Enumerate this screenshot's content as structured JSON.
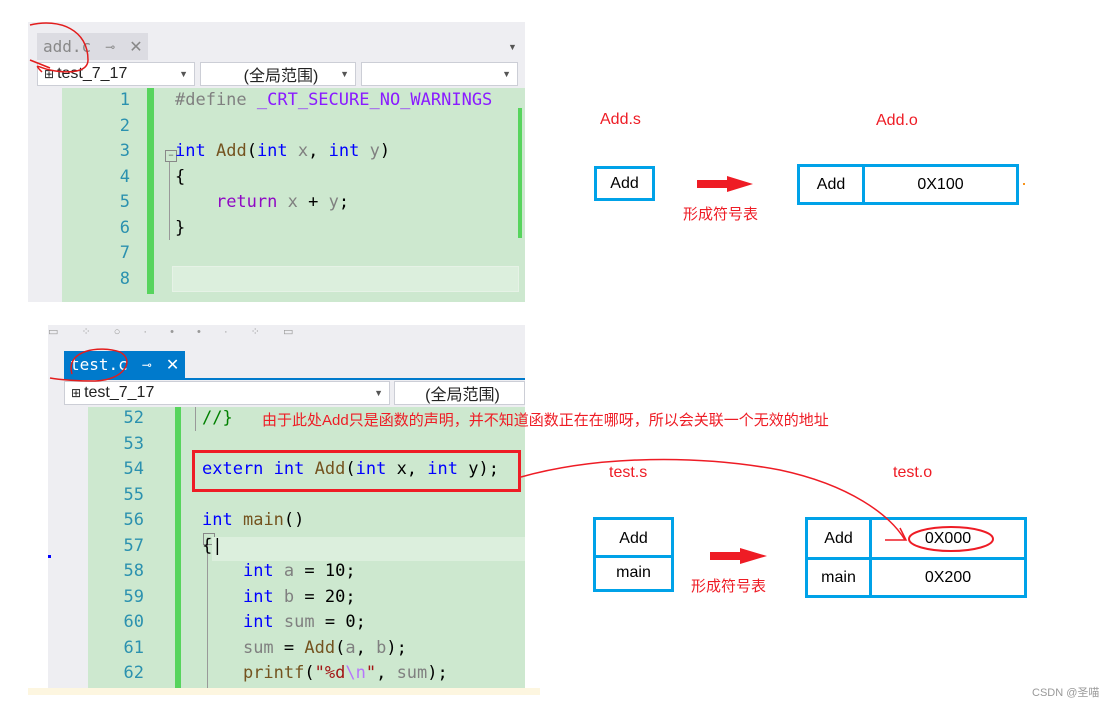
{
  "top_editor": {
    "tab_label": "add.c",
    "pin_icon": "pin-icon",
    "close_icon": "close-icon",
    "project_dropdown": "test_7_17",
    "scope_dropdown": "(全局范围)",
    "member_dropdown": "",
    "line_numbers": [
      "1",
      "2",
      "3",
      "4",
      "5",
      "6",
      "7",
      "8"
    ]
  },
  "bottom_editor": {
    "tab_label": "test.c",
    "project_dropdown": "test_7_17",
    "scope_dropdown": "(全局范围)",
    "line_numbers": [
      "52",
      "53",
      "54",
      "55",
      "56",
      "57",
      "58",
      "59",
      "60",
      "61",
      "62"
    ],
    "annotation": "由于此处Add只是函数的声明，并不知道函数正在在哪呀，所以会关联一个无效的地址"
  },
  "top_diagram": {
    "source_label": "Add.s",
    "source_symbols": [
      "Add"
    ],
    "arrow_label": "形成符号表",
    "object_label": "Add.o",
    "table": [
      {
        "symbol": "Add",
        "address": "0X100"
      }
    ]
  },
  "bottom_diagram": {
    "source_label": "test.s",
    "source_symbols": [
      "Add",
      "main"
    ],
    "arrow_label": "形成符号表",
    "object_label": "test.o",
    "table": [
      {
        "symbol": "Add",
        "address": "0X000"
      },
      {
        "symbol": "main",
        "address": "0X200"
      }
    ]
  },
  "watermark": "CSDN @圣喵",
  "colors": {
    "annotation_red": "#ee1c25",
    "table_blue": "#00a2e8",
    "tab_active": "#007acc",
    "editor_green": "#cde8cf"
  }
}
